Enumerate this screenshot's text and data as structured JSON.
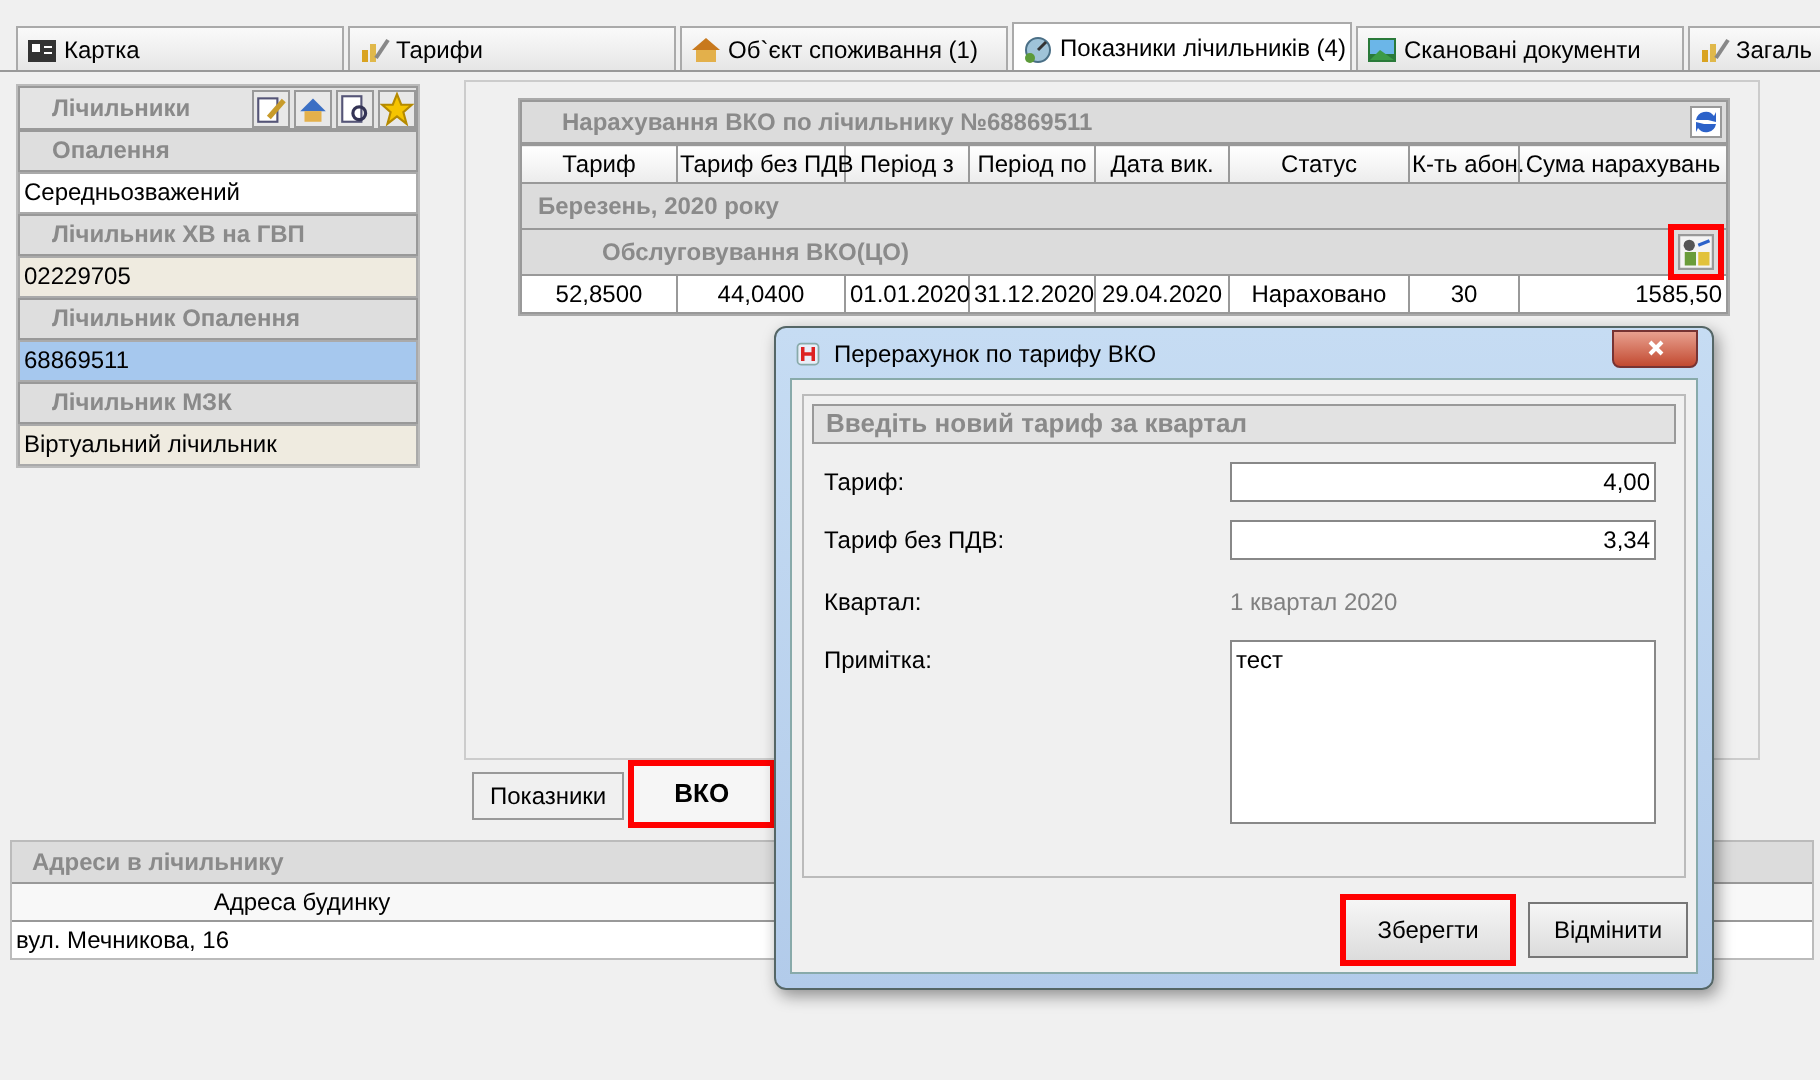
{
  "tabs": [
    {
      "label": "Картка",
      "kind": "card",
      "selected": false
    },
    {
      "label": "Тарифи",
      "kind": "tariff",
      "selected": false
    },
    {
      "label": "Об`єкт споживання (1)",
      "kind": "house",
      "selected": false
    },
    {
      "label": "Показники лічильників (4)",
      "kind": "meter",
      "selected": true
    },
    {
      "label": "Скановані документи",
      "kind": "picture",
      "selected": false
    },
    {
      "label": "Загаль",
      "kind": "tariff",
      "selected": false
    }
  ],
  "meters_panel": {
    "title": "Лічильники",
    "groups": [
      {
        "header": "Опалення",
        "value": "Середньозважений",
        "selected": false,
        "plain": true
      },
      {
        "header": "Лічильник ХВ на ГВП",
        "value": "02229705",
        "selected": false,
        "plain": false
      },
      {
        "header": "Лічильник Опалення",
        "value": "68869511",
        "selected": true,
        "plain": false
      },
      {
        "header": "Лічильник МЗК",
        "value": "Віртуальний лічильник",
        "selected": false,
        "plain": false
      }
    ]
  },
  "charges": {
    "title": "Нарахування ВКО по лічильнику №68869511",
    "columns": [
      "Тариф",
      "Тариф без ПДВ",
      "Період з",
      "Період по",
      "Дата вик.",
      "Статус",
      "К-ть абон.",
      "Сума нарахувань"
    ],
    "group": "Березень, 2020 року",
    "subgroup": "Обслуговування ВКО(ЦО)",
    "recalc_highlighted": true,
    "rows": [
      {
        "cells": [
          "52,8500",
          "44,0400",
          "01.01.2020",
          "31.12.2020",
          "29.04.2020",
          "Нараховано",
          "30",
          "1585,50"
        ]
      }
    ]
  },
  "bottom_tabs": [
    {
      "label": "Показники",
      "selected": false,
      "highlighted": false
    },
    {
      "label": "ВКО",
      "selected": true,
      "highlighted": true
    }
  ],
  "addresses": {
    "title": "Адреси в лічильнику",
    "column": "Адреса будинку",
    "rows": [
      "вул. Мечникова, 16"
    ]
  },
  "dialog": {
    "title": "Перерахунок по тарифу ВКО",
    "group": "Введіть новий тариф за квартал",
    "fields": [
      {
        "label": "Тариф:",
        "value": "4,00",
        "kind": "input"
      },
      {
        "label": "Тариф без ПДВ:",
        "value": "3,34",
        "kind": "input"
      },
      {
        "label": "Квартал:",
        "value": "1 квартал 2020",
        "kind": "readonly"
      },
      {
        "label": "Примітка:",
        "value": "тест",
        "kind": "memo"
      }
    ],
    "buttons": [
      {
        "label": "Зберегти",
        "highlighted": true
      },
      {
        "label": "Відмінити",
        "highlighted": false
      }
    ]
  }
}
